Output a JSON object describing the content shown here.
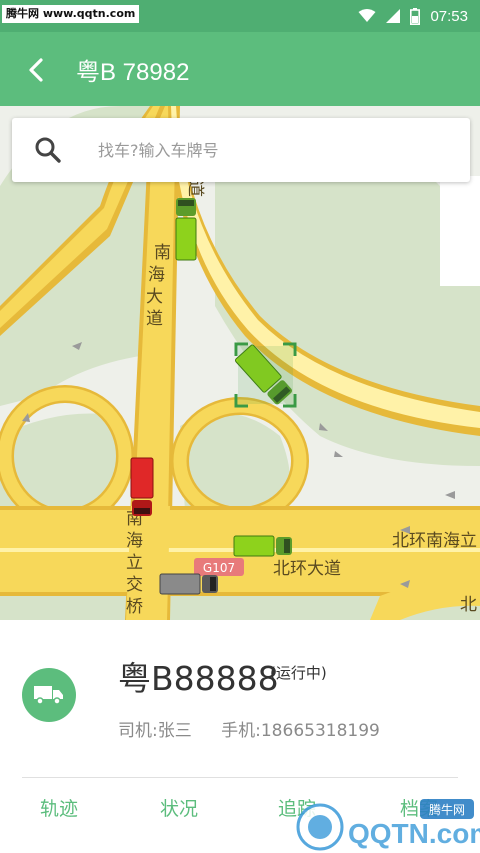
{
  "status_bar": {
    "watermark": "腾牛网 www.qqtn.com",
    "time": "07:53",
    "icons": [
      "wifi-icon",
      "signal-icon",
      "battery-icon"
    ]
  },
  "header": {
    "title": "粤B 78982",
    "back_icon": "chevron-left-icon"
  },
  "search": {
    "placeholder": "找车?输入车牌号",
    "value": ""
  },
  "map": {
    "labels": {
      "road_1": "南海大道",
      "road_2": "南海立交桥",
      "road_3": "北环南海立",
      "road_4": "北环大道",
      "road_5": "北",
      "road_top": "道",
      "shield": "G107"
    },
    "vehicles": [
      {
        "color": "green",
        "selected": false
      },
      {
        "color": "green",
        "selected": true
      },
      {
        "color": "red",
        "selected": false
      },
      {
        "color": "green",
        "selected": false
      },
      {
        "color": "gray",
        "selected": false
      }
    ]
  },
  "vehicle_panel": {
    "plate": "粤B88888",
    "status": "(运行中)",
    "driver_label": "司机:张三",
    "phone_label": "手机:18665318199"
  },
  "tabs": [
    "轨迹",
    "状况",
    "追踪",
    "档案"
  ],
  "watermark_bottom": {
    "brand": "QQTN.com",
    "badge": "腾牛网"
  },
  "colors": {
    "primary": "#5cbd7d",
    "status_bar": "#4fae72",
    "road": "#f7d85a",
    "road_edge": "#e6b93a"
  }
}
